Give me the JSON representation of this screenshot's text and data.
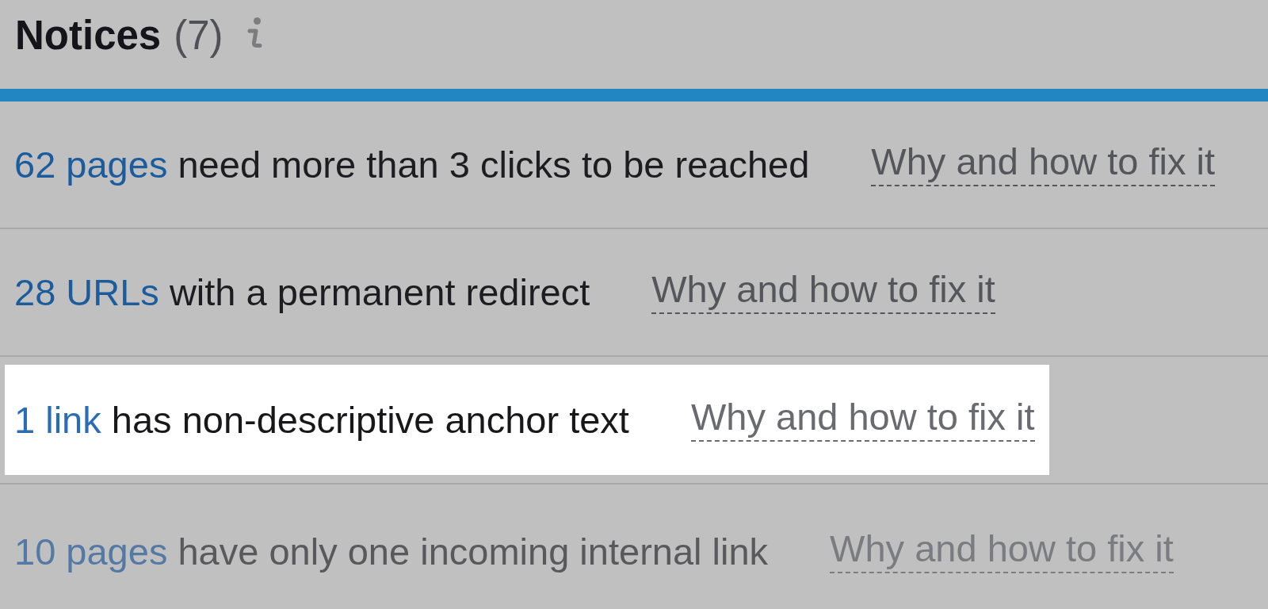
{
  "header": {
    "title": "Notices",
    "count": "(7)"
  },
  "rows": [
    {
      "count_link": "62 pages",
      "text": "need more than 3 clicks to be reached",
      "help_link": "Why and how to fix it",
      "highlighted": false,
      "dimmed": false
    },
    {
      "count_link": "28 URLs",
      "text": "with a permanent redirect",
      "help_link": "Why and how to fix it",
      "highlighted": false,
      "dimmed": false
    },
    {
      "count_link": "1 link",
      "text": "has non-descriptive anchor text",
      "help_link": "Why and how to fix it",
      "highlighted": true,
      "dimmed": false
    },
    {
      "count_link": "10 pages",
      "text": "have only one incoming internal link",
      "help_link": "Why and how to fix it",
      "highlighted": false,
      "dimmed": true
    }
  ]
}
